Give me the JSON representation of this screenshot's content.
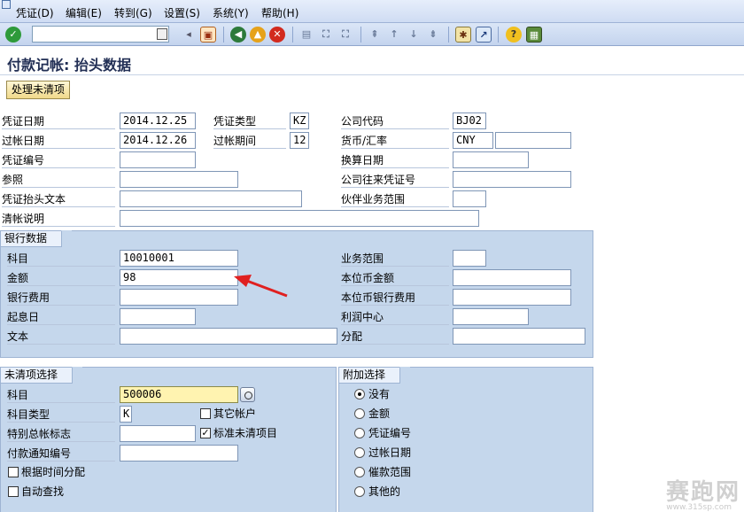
{
  "menu": [
    "凭证(D)",
    "编辑(E)",
    "转到(G)",
    "设置(S)",
    "系统(Y)",
    "帮助(H)"
  ],
  "title": "付款记帐: 抬头数据",
  "app_button": "处理未清项",
  "header": {
    "doc_date_label": "凭证日期",
    "doc_date": "2014.12.25",
    "doc_type_label": "凭证类型",
    "doc_type": "KZ",
    "company_label": "公司代码",
    "company": "BJ02",
    "post_date_label": "过帐日期",
    "post_date": "2014.12.26",
    "period_label": "过帐期间",
    "period": "12",
    "currency_label": "货币/汇率",
    "currency": "CNY",
    "doc_no_label": "凭证编号",
    "trans_date_label": "换算日期",
    "ref_label": "参照",
    "intercompany_label": "公司往来凭证号",
    "header_text_label": "凭证抬头文本",
    "partner_ba_label": "伙伴业务范围",
    "clearing_text_label": "清帐说明"
  },
  "bank": {
    "title": "银行数据",
    "account_label": "科目",
    "account": "10010001",
    "ba_label": "业务范围",
    "amount_label": "金额",
    "amount": "98",
    "lc_amount_label": "本位币金额",
    "bank_fee_label": "银行费用",
    "lc_bank_fee_label": "本位币银行费用",
    "value_date_label": "起息日",
    "profit_center_label": "利润中心",
    "text_label": "文本",
    "assignment_label": "分配"
  },
  "open_items": {
    "title": "未清项选择",
    "account_label": "科目",
    "account": "500006",
    "acct_type_label": "科目类型",
    "acct_type": "K",
    "other_accounts_label": "其它帐户",
    "special_gl_label": "特别总帐标志",
    "std_open_items_label": "标准未清项目",
    "payment_advice_label": "付款通知编号",
    "distribute_by_age_label": "根据时间分配",
    "auto_search_label": "自动查找"
  },
  "additional": {
    "title": "附加选择",
    "options": [
      "没有",
      "金额",
      "凭证编号",
      "过帐日期",
      "催款范围",
      "其他的"
    ]
  },
  "watermark": "赛跑网",
  "watermark_url": "www.315sp.com"
}
